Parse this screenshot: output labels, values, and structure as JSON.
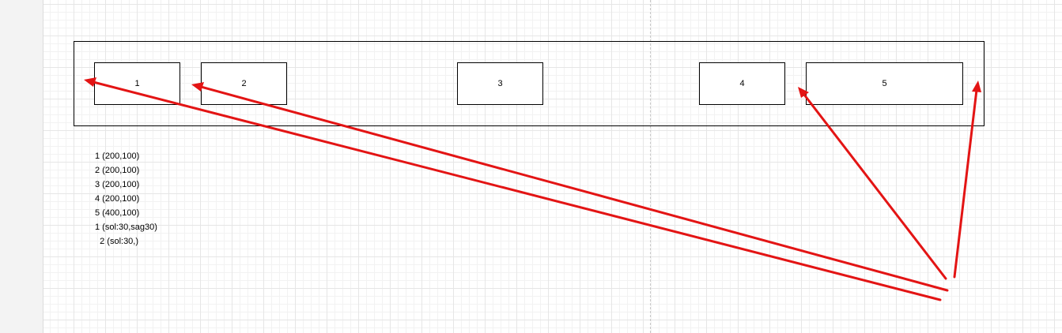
{
  "diagram": {
    "nodes": [
      {
        "id": "node-1",
        "label": "1"
      },
      {
        "id": "node-2",
        "label": "2"
      },
      {
        "id": "node-3",
        "label": "3"
      },
      {
        "id": "node-4",
        "label": "4"
      },
      {
        "id": "node-5",
        "label": "5"
      }
    ],
    "notes": [
      "1 (200,100)",
      "2 (200,100)",
      "3 (200,100)",
      "4 (200,100)",
      "5 (400,100)",
      "1 (sol:30,sag30)",
      "  2 (sol:30,)"
    ],
    "annotation_color": "#e31414",
    "arrow_targets": [
      "node-1",
      "node-2",
      "node-5",
      "container-right-edge"
    ]
  }
}
